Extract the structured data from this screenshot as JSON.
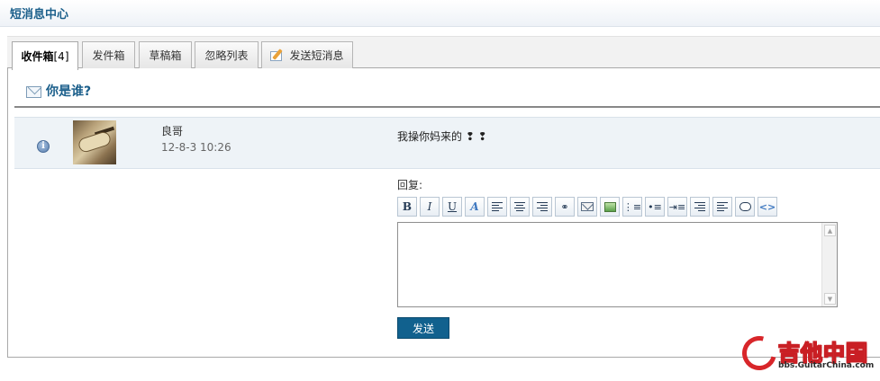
{
  "header": {
    "title": "短消息中心"
  },
  "tabs": [
    {
      "label": "收件箱",
      "count": "[4]",
      "active": true
    },
    {
      "label": "发件箱"
    },
    {
      "label": "草稿箱"
    },
    {
      "label": "忽略列表"
    },
    {
      "label": "发送短消息",
      "icon": "compose-icon"
    }
  ],
  "section": {
    "title": "你是谁?",
    "icon": "envelope-icon"
  },
  "message": {
    "sender": "良哥",
    "time": "12-8-3 10:26",
    "body": "我操你妈来的 ❢ ❢",
    "status_icon": "info-icon"
  },
  "reply": {
    "label": "回复:",
    "toolbar": [
      {
        "name": "bold",
        "glyph": "B"
      },
      {
        "name": "italic",
        "glyph": "I"
      },
      {
        "name": "underline",
        "glyph": "U"
      },
      {
        "name": "font-color",
        "glyph": "A"
      },
      {
        "name": "align-left"
      },
      {
        "name": "align-center"
      },
      {
        "name": "align-right"
      },
      {
        "name": "link",
        "glyph": "⚭"
      },
      {
        "name": "email"
      },
      {
        "name": "image"
      },
      {
        "name": "ordered-list",
        "glyph": "⋮≡"
      },
      {
        "name": "unordered-list",
        "glyph": "•≡"
      },
      {
        "name": "indent",
        "glyph": "⇥≡"
      },
      {
        "name": "float-left"
      },
      {
        "name": "float-right"
      },
      {
        "name": "quote"
      },
      {
        "name": "code",
        "glyph": "<>"
      }
    ],
    "textarea_value": "",
    "send_label": "发送"
  },
  "watermark": {
    "brand": "吉他中国",
    "url": "bbs.GuitarChina.com"
  },
  "colors": {
    "accent": "#1b5f8b",
    "send_button": "#11618e",
    "row_bg": "#eef3f7"
  }
}
